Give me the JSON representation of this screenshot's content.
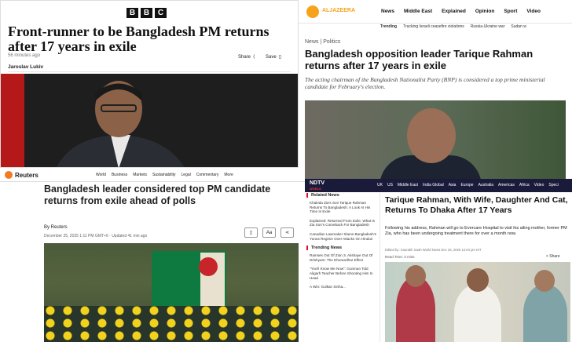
{
  "bbc": {
    "logo_letters": [
      "B",
      "B",
      "C"
    ],
    "headline": "Front-runner to be Bangladesh PM returns after 17 years in exile",
    "time": "56 minutes ago",
    "share_label": "Share",
    "save_label": "Save",
    "author": "Jaroslav Lukiv"
  },
  "aljazeera": {
    "logo_text": "ALJAZEERA",
    "nav": [
      "News",
      "Middle East",
      "Explained",
      "Opinion",
      "Sport",
      "Video"
    ],
    "trending_label": "Trending",
    "trending": [
      "Tracking Israeli ceasefire violations",
      "Russia-Ukraine war",
      "Sudan w"
    ],
    "category_news": "News",
    "category_sep": "|",
    "category_politics": "Politics",
    "headline": "Bangladesh opposition leader Tarique Rahman returns after 17 years in exile",
    "subhead": "The acting chairman of the Bangladesh Nationalist Party (BNP) is considered a top prime ministerial candidate for February's election."
  },
  "reuters": {
    "logo_text": "Reuters",
    "nav": [
      "World",
      "Business",
      "Markets",
      "Sustainability",
      "Legal",
      "Commentary",
      "More"
    ],
    "headline": "Bangladesh leader considered top PM candidate returns from exile ahead of polls",
    "byline": "By Reuters",
    "date": "December 25, 2025 1:11 PM GMT+6 · Updated 41 min ago",
    "tool_text": "Aa"
  },
  "ndtv": {
    "logo_top": "NDTV",
    "logo_bottom": "WORLD",
    "nav": [
      "UK",
      "US",
      "Middle East",
      "India Global",
      "Asia",
      "Europe",
      "Australia",
      "Americas",
      "Africa",
      "Video",
      "Speci"
    ],
    "related_heading": "Related News",
    "related": [
      "Khaleda Zia's Son Tarique Rahman Returns To Bangladesh: A Look At His Time In Exile",
      "Explained: Returned From Exile, What Is Zia Son's Comeback For Bangladesh",
      "Canadian Lawmaker Slams Bangladesh's Yunus Regime Over Attacks On Hindus"
    ],
    "trending_heading": "Trending News",
    "trending": [
      "Ramses Out Of Zion 3, Akshaye Out Of Drishyam: The Dhurandhar Effect",
      "\"You'll Know Me Now\": Gunman Told Aligarh Teacher Before Shooting Him In Head",
      "A Win: Gulkan Sinha..."
    ],
    "headline": "Tarique Rahman, With Wife, Daughter And Cat, Returns To Dhaka After 17 Years",
    "body": "Following his address, Rahman will go to Evercare Hospital to visit his ailing mother, former PM Zia, who has been undergoing treatment there for over a month now.",
    "meta": "Edited by: Saurabh Saah   World News   Dec 25, 2025 12:04 pm IST",
    "read_time": "Read Time: 3 mins",
    "share_label": "< Share"
  }
}
